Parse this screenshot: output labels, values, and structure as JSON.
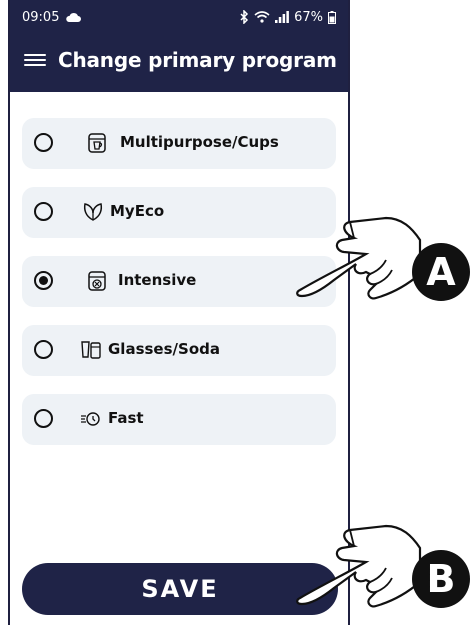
{
  "status_bar": {
    "time": "09:05",
    "battery": "67%"
  },
  "header": {
    "title": "Change primary program"
  },
  "programs": [
    {
      "label": "Multipurpose/Cups",
      "selected": false,
      "icon": "multipurpose-icon"
    },
    {
      "label": "MyEco",
      "selected": false,
      "icon": "eco-leaf-icon"
    },
    {
      "label": "Intensive",
      "selected": true,
      "icon": "intensive-icon"
    },
    {
      "label": "Glasses/Soda",
      "selected": false,
      "icon": "glasses-icon"
    },
    {
      "label": "Fast",
      "selected": false,
      "icon": "fast-icon"
    }
  ],
  "save_label": "SAVE",
  "callouts": {
    "a": "A",
    "b": "B"
  },
  "colors": {
    "header_bg": "#1f2347",
    "option_bg": "#eef2f6"
  }
}
